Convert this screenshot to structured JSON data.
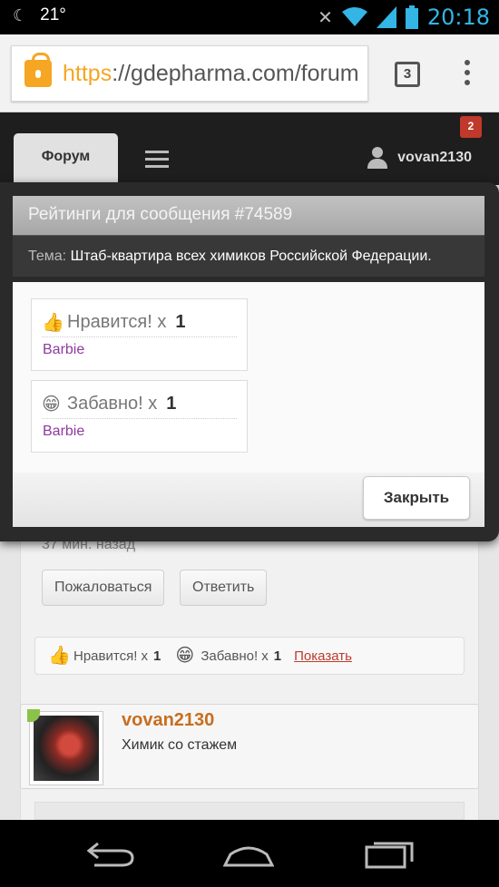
{
  "status_bar": {
    "temperature": "21°",
    "time": "20:18"
  },
  "browser": {
    "url_scheme": "https",
    "url_rest": "://gdepharma.com/forum",
    "tab_count": "3"
  },
  "header": {
    "forum_tab": "Форум",
    "username": "vovan2130",
    "notification_count": "2"
  },
  "background_post": {
    "time_ago": "37 мин. назад",
    "report_button": "Пожаловаться",
    "reply_button": "Ответить",
    "likes_summary": {
      "like_label": "Нравится! x",
      "like_count": "1",
      "funny_label": "Забавно! x",
      "funny_count": "1",
      "show_link": "Показать"
    },
    "author": {
      "name": "vovan2130",
      "title": "Химик со стажем"
    }
  },
  "modal": {
    "title": "Рейтинги для сообщения #74589",
    "subject_label": "Тема:",
    "subject": "Штаб-квартира всех химиков Российской Федерации.",
    "ratings": [
      {
        "icon": "thumbs-up-icon",
        "label": "Нравится! x",
        "count": "1",
        "user": "Barbie"
      },
      {
        "icon": "laughing-face-icon",
        "label": "Забавно! x",
        "count": "1",
        "user": "Barbie"
      }
    ],
    "close_button": "Закрыть"
  },
  "colors": {
    "accent_blue": "#33b5e5",
    "url_scheme": "#f5a623",
    "username_link": "#8e3a9e",
    "author_name": "#c86d1f",
    "show_link": "#c0392b"
  }
}
